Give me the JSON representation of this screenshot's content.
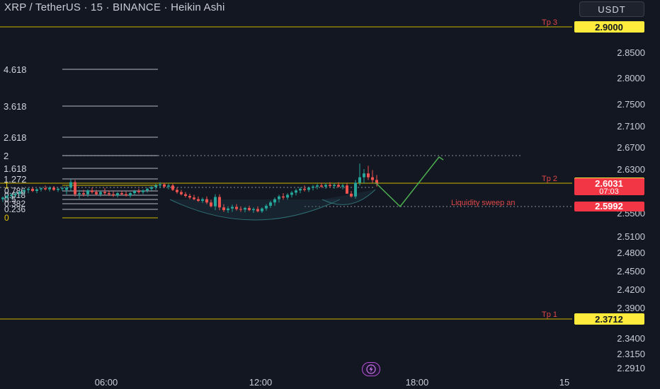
{
  "header": {
    "title": "XRP / TetherUS · 15 · BINANCE · Heikin Ashi",
    "currency_button": "USDT"
  },
  "colors": {
    "background": "#131722",
    "up": "#26a69a",
    "down": "#ef5350",
    "target_line": "#c8b400",
    "target_badge": "#ffeb3b",
    "price_badge_red": "#f23645",
    "projection": "#4caf50",
    "fib_lines": "#d1d4dc",
    "dotted": "#8a8e99"
  },
  "chart_data": {
    "type": "candlestick",
    "style": "Heikin Ashi",
    "x_ticks": [
      "06:00",
      "12:00",
      "18:00",
      "15"
    ],
    "y_ticks": [
      "2.8500",
      "2.8000",
      "2.7500",
      "2.7100",
      "2.6700",
      "2.6300",
      "2.5500",
      "2.5100",
      "2.4800",
      "2.4500",
      "2.4200",
      "2.3900",
      "2.3400",
      "2.3150",
      "2.2910"
    ],
    "horizontal_levels": [
      {
        "label": "Tp 3",
        "value": 2.9,
        "badge": "2.9000"
      },
      {
        "label": "Tp 2",
        "value": 2.603,
        "badge": "2.6030"
      },
      {
        "label": "Tp 1",
        "value": 2.3712,
        "badge": "2.3712"
      }
    ],
    "price_badges": [
      {
        "value": "2.6031",
        "countdown": "07:03"
      },
      {
        "value": "2.5992"
      }
    ],
    "annotation": "Liquidity sweep an",
    "fib_labels": [
      "4.618",
      "3.618",
      "2.618",
      "2",
      "1.618",
      "1.272",
      "1",
      "0.786",
      "0.618",
      "0.5",
      "0.382",
      "0.236",
      "0"
    ],
    "candles": [
      [
        2.575,
        2.58,
        2.57,
        2.578
      ],
      [
        2.578,
        2.584,
        2.574,
        2.581
      ],
      [
        2.581,
        2.586,
        2.576,
        2.583
      ],
      [
        2.583,
        2.588,
        2.578,
        2.585
      ],
      [
        2.585,
        2.59,
        2.58,
        2.589
      ],
      [
        2.589,
        2.593,
        2.584,
        2.592
      ],
      [
        2.592,
        2.596,
        2.586,
        2.594
      ],
      [
        2.594,
        2.597,
        2.588,
        2.59
      ],
      [
        2.59,
        2.595,
        2.586,
        2.593
      ],
      [
        2.593,
        2.597,
        2.589,
        2.595
      ],
      [
        2.595,
        2.6,
        2.591,
        2.593
      ],
      [
        2.593,
        2.598,
        2.589,
        2.596
      ],
      [
        2.596,
        2.599,
        2.59,
        2.592
      ],
      [
        2.592,
        2.596,
        2.588,
        2.594
      ],
      [
        2.594,
        2.598,
        2.59,
        2.595
      ],
      [
        2.592,
        2.599,
        2.584,
        2.596
      ],
      [
        2.596,
        2.612,
        2.59,
        2.606
      ],
      [
        2.606,
        2.61,
        2.58,
        2.584
      ],
      [
        2.584,
        2.592,
        2.576,
        2.586
      ],
      [
        2.586,
        2.592,
        2.58,
        2.584
      ],
      [
        2.584,
        2.593,
        2.579,
        2.591
      ],
      [
        2.591,
        2.596,
        2.585,
        2.588
      ],
      [
        2.588,
        2.592,
        2.582,
        2.584
      ],
      [
        2.584,
        2.591,
        2.58,
        2.588
      ],
      [
        2.588,
        2.595,
        2.583,
        2.586
      ],
      [
        2.586,
        2.591,
        2.581,
        2.584
      ],
      [
        2.584,
        2.589,
        2.579,
        2.582
      ],
      [
        2.582,
        2.588,
        2.578,
        2.586
      ],
      [
        2.586,
        2.59,
        2.582,
        2.584
      ],
      [
        2.584,
        2.589,
        2.58,
        2.582
      ],
      [
        2.582,
        2.588,
        2.578,
        2.586
      ],
      [
        2.586,
        2.592,
        2.582,
        2.59
      ],
      [
        2.59,
        2.594,
        2.585,
        2.588
      ],
      [
        2.588,
        2.593,
        2.584,
        2.591
      ],
      [
        2.591,
        2.596,
        2.587,
        2.594
      ],
      [
        2.594,
        2.599,
        2.59,
        2.597
      ],
      [
        2.597,
        2.603,
        2.592,
        2.6
      ],
      [
        2.6,
        2.606,
        2.595,
        2.602
      ],
      [
        2.602,
        2.605,
        2.595,
        2.598
      ],
      [
        2.598,
        2.603,
        2.593,
        2.6
      ],
      [
        2.6,
        2.603,
        2.59,
        2.592
      ],
      [
        2.592,
        2.596,
        2.585,
        2.588
      ],
      [
        2.588,
        2.592,
        2.582,
        2.584
      ],
      [
        2.584,
        2.588,
        2.578,
        2.581
      ],
      [
        2.581,
        2.585,
        2.575,
        2.578
      ],
      [
        2.578,
        2.583,
        2.573,
        2.575
      ],
      [
        2.575,
        2.58,
        2.57,
        2.572
      ],
      [
        2.572,
        2.578,
        2.568,
        2.575
      ],
      [
        2.575,
        2.58,
        2.566,
        2.569
      ],
      [
        2.569,
        2.574,
        2.56,
        2.562
      ],
      [
        2.562,
        2.584,
        2.555,
        2.579
      ],
      [
        2.579,
        2.584,
        2.555,
        2.56
      ],
      [
        2.56,
        2.566,
        2.552,
        2.555
      ],
      [
        2.555,
        2.562,
        2.55,
        2.558
      ],
      [
        2.558,
        2.565,
        2.552,
        2.561
      ],
      [
        2.561,
        2.566,
        2.554,
        2.557
      ],
      [
        2.557,
        2.562,
        2.552,
        2.556
      ],
      [
        2.556,
        2.561,
        2.551,
        2.559
      ],
      [
        2.559,
        2.563,
        2.553,
        2.555
      ],
      [
        2.555,
        2.56,
        2.55,
        2.557
      ],
      [
        2.557,
        2.562,
        2.551,
        2.553
      ],
      [
        2.553,
        2.56,
        2.55,
        2.558
      ],
      [
        2.558,
        2.566,
        2.554,
        2.563
      ],
      [
        2.563,
        2.572,
        2.559,
        2.569
      ],
      [
        2.569,
        2.578,
        2.563,
        2.575
      ],
      [
        2.575,
        2.583,
        2.569,
        2.58
      ],
      [
        2.58,
        2.586,
        2.574,
        2.578
      ],
      [
        2.578,
        2.586,
        2.574,
        2.583
      ],
      [
        2.583,
        2.59,
        2.578,
        2.587
      ],
      [
        2.587,
        2.594,
        2.582,
        2.591
      ],
      [
        2.591,
        2.597,
        2.586,
        2.594
      ],
      [
        2.594,
        2.6,
        2.589,
        2.592
      ],
      [
        2.592,
        2.598,
        2.588,
        2.596
      ],
      [
        2.596,
        2.601,
        2.591,
        2.598
      ],
      [
        2.598,
        2.603,
        2.593,
        2.6
      ],
      [
        2.6,
        2.605,
        2.596,
        2.598
      ],
      [
        2.598,
        2.604,
        2.594,
        2.601
      ],
      [
        2.601,
        2.606,
        2.596,
        2.599
      ],
      [
        2.599,
        2.604,
        2.594,
        2.601
      ],
      [
        2.601,
        2.606,
        2.596,
        2.598
      ],
      [
        2.598,
        2.603,
        2.593,
        2.6
      ],
      [
        2.6,
        2.604,
        2.59,
        2.585
      ],
      [
        2.585,
        2.59,
        2.578,
        2.58
      ],
      [
        2.58,
        2.61,
        2.576,
        2.605
      ],
      [
        2.605,
        2.64,
        2.6,
        2.615
      ],
      [
        2.615,
        2.63,
        2.604,
        2.622
      ],
      [
        2.622,
        2.636,
        2.61,
        2.615
      ],
      [
        2.615,
        2.628,
        2.605,
        2.61
      ],
      [
        2.61,
        2.619,
        2.598,
        2.603
      ]
    ]
  }
}
